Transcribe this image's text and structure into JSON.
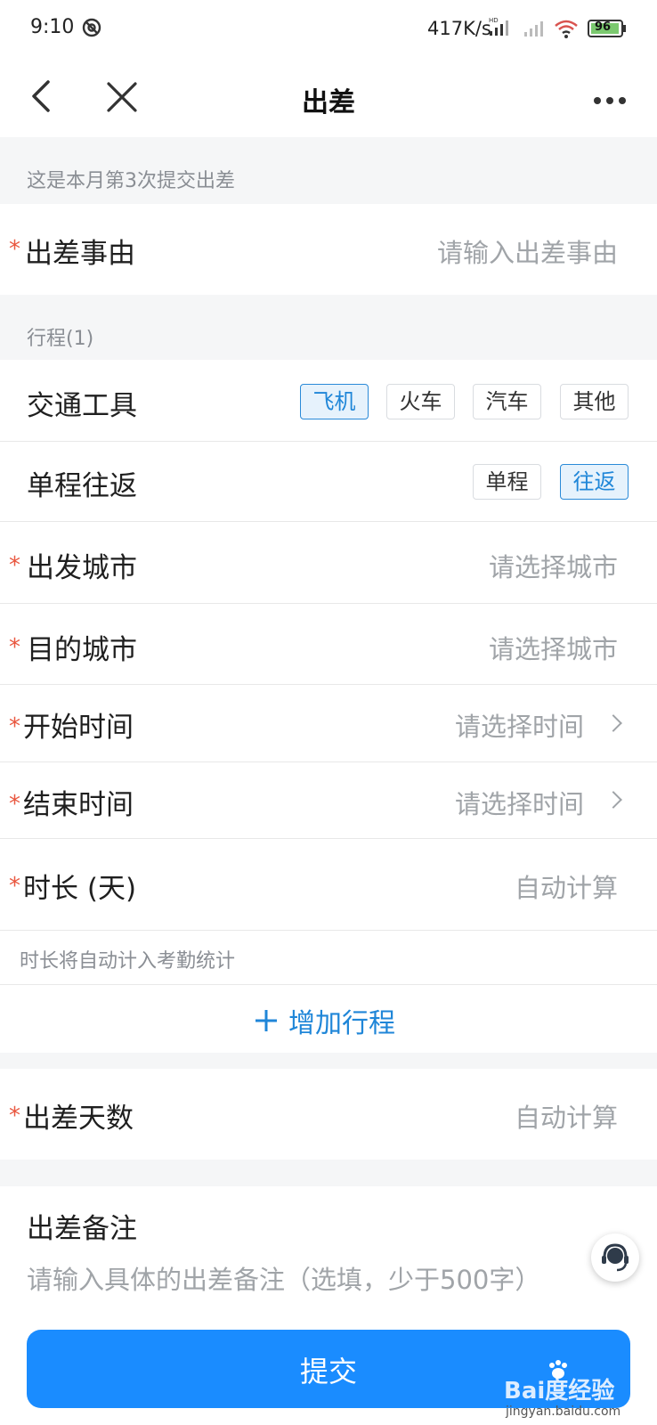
{
  "status_bar": {
    "time": "9:10",
    "network_speed": "417K/s",
    "battery": "96"
  },
  "header": {
    "title": "出差"
  },
  "notice": "这是本月第3次提交出差",
  "reason": {
    "label": "出差事由",
    "placeholder": "请输入出差事由"
  },
  "trip": {
    "section_title": "行程(1)",
    "transport": {
      "label": "交通工具",
      "options": [
        "飞机",
        "火车",
        "汽车",
        "其他"
      ],
      "selected": "飞机"
    },
    "trip_type": {
      "label": "单程往返",
      "options": [
        "单程",
        "往返"
      ],
      "selected": "往返"
    },
    "departure": {
      "label": "出发城市",
      "placeholder": "请选择城市"
    },
    "destination": {
      "label": "目的城市",
      "placeholder": "请选择城市"
    },
    "start_time": {
      "label": "开始时间",
      "placeholder": "请选择时间"
    },
    "end_time": {
      "label": "结束时间",
      "placeholder": "请选择时间"
    },
    "duration": {
      "label": "时长 (天)",
      "placeholder": "自动计算"
    },
    "hint": "时长将自动计入考勤统计",
    "add_label": "增加行程"
  },
  "days": {
    "label": "出差天数",
    "placeholder": "自动计算"
  },
  "remarks": {
    "label": "出差备注",
    "placeholder": "请输入具体的出差备注（选填，少于500字）"
  },
  "submit_label": "提交",
  "watermark": {
    "brand": "Bai度经验",
    "url": "jingyan.baidu.com"
  },
  "colors": {
    "accent": "#1a8cff",
    "active_chip": "#2a8ad8",
    "required": "#e9573f"
  }
}
